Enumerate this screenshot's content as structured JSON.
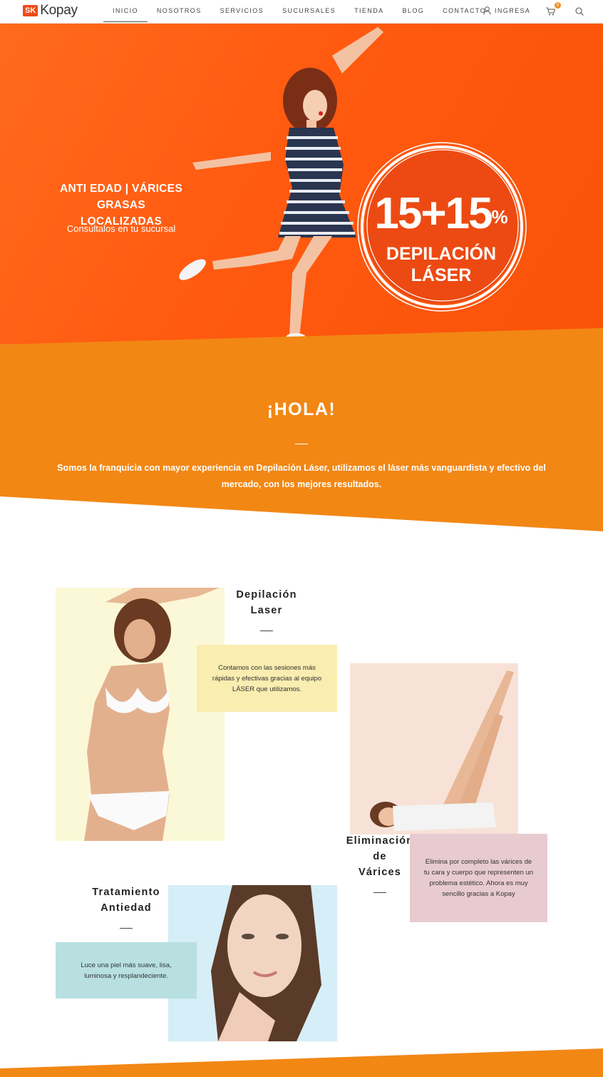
{
  "nav": {
    "logo_badge": "SK",
    "logo_text": "Kopay",
    "items": [
      "INICIO",
      "NOSOTROS",
      "SERVICIOS",
      "SUCURSALES",
      "TIENDA",
      "BLOG",
      "CONTACTO"
    ],
    "active_index": 0,
    "login_label": "INGRESA",
    "cart_count": "0"
  },
  "hero": {
    "line1": "ANTI EDAD | VÁRICES",
    "line2": "GRASAS LOCALIZADAS",
    "subtitle": "Consúltalos en tu sucursal",
    "promo_number": "15+15",
    "promo_percent": "%",
    "promo_line1": "DEPILACIÓN",
    "promo_line2": "LÁSER"
  },
  "intro": {
    "title": "¡HOLA!",
    "body": "Somos la franquicia con mayor experiencia en Depilación Láser, utilizamos el láser más vanguardista y efectivo del mercado, con los mejores resultados."
  },
  "services": [
    {
      "title_line1": "Depilación",
      "title_line2": "Laser",
      "description": "Contamos con las sesiones más rápidas y efectivas gracias al equipo LÁSER que utilizamos."
    },
    {
      "title_line1": "Eliminación",
      "title_line2": "de",
      "title_line3": "Várices",
      "description": "Elimina por completo las várices de tu cara y cuerpo que representen un problema estético. Ahora es muy sencillo gracias a Kopay"
    },
    {
      "title_line1": "Tratamiento",
      "title_line2": "Antiedad",
      "description": "Luce una piel más suave, lisa, luminosa y resplandeciente."
    }
  ],
  "colors": {
    "hero_orange": "#ff5a10",
    "band_orange": "#f28714",
    "card_yellow": "#f9edb0",
    "card_pink": "#e8cbd0",
    "card_teal": "#b8e0e1"
  }
}
